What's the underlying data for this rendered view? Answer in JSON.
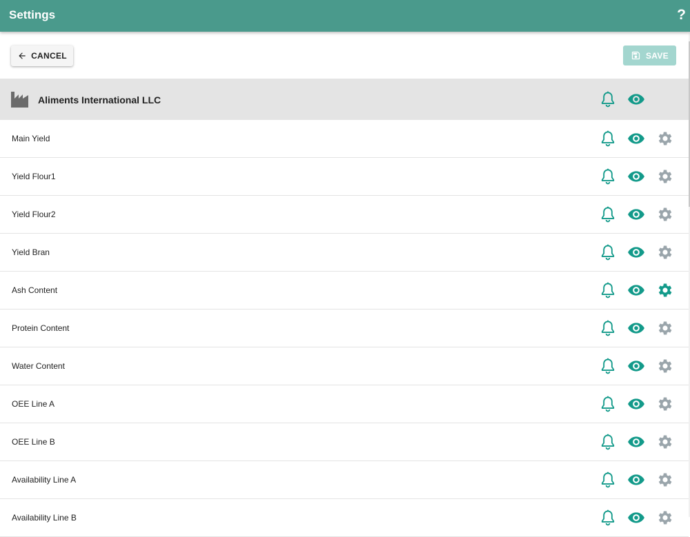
{
  "appbar": {
    "title": "Settings",
    "help": "?"
  },
  "toolbar": {
    "cancel_label": "CANCEL",
    "save_label": "SAVE"
  },
  "group": {
    "title": "Aliments International LLC"
  },
  "colors": {
    "appbar": "#4a9a8c",
    "accent": "#139a8a",
    "gear_inactive": "#9aa5ab",
    "save_disabled": "#a3d6cf"
  },
  "icons": {
    "bell": "bell-icon",
    "eye": "eye-icon",
    "gear": "gear-icon",
    "group": "factory-icon"
  },
  "rows": [
    {
      "label": "Main Yield",
      "gear_active": false
    },
    {
      "label": "Yield Flour1",
      "gear_active": false
    },
    {
      "label": "Yield Flour2",
      "gear_active": false
    },
    {
      "label": "Yield Bran",
      "gear_active": false
    },
    {
      "label": "Ash Content",
      "gear_active": true
    },
    {
      "label": "Protein Content",
      "gear_active": false
    },
    {
      "label": "Water Content",
      "gear_active": false
    },
    {
      "label": "OEE Line A",
      "gear_active": false
    },
    {
      "label": "OEE Line B",
      "gear_active": false
    },
    {
      "label": "Availability Line A",
      "gear_active": false
    },
    {
      "label": "Availability Line B",
      "gear_active": false
    }
  ]
}
